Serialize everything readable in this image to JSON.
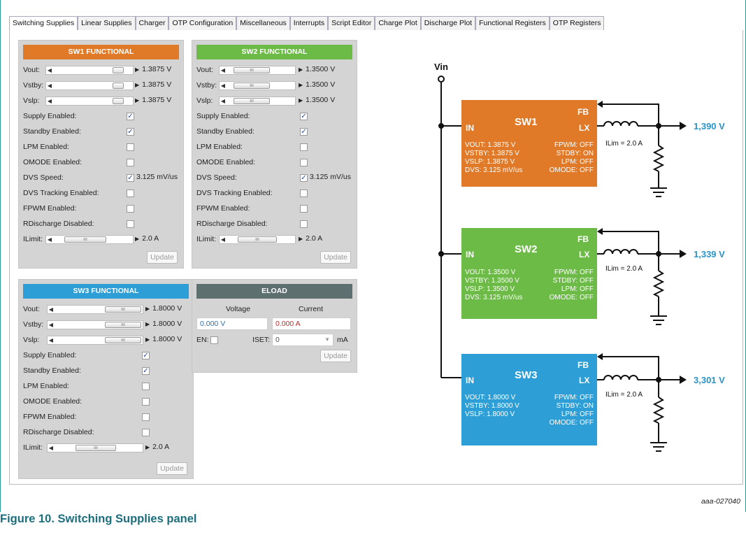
{
  "tabs": [
    "Switching Supplies",
    "Linear Supplies",
    "Charger",
    "OTP Configuration",
    "Miscellaneous",
    "Interrupts",
    "Script Editor",
    "Charge Plot",
    "Discharge Plot",
    "Functional Registers",
    "OTP Registers"
  ],
  "colors": {
    "sw1": "#e07a28",
    "sw2": "#6cbb46",
    "sw3": "#2d9fd6",
    "eload": "#5d6f6f",
    "output": "#2a93c8"
  },
  "sw1": {
    "title": "SW1 FUNCTIONAL",
    "vout_label": "Vout:",
    "vout_value": "1.3875 V",
    "vstby_label": "Vstby:",
    "vstby_value": "1.3875 V",
    "vslp_label": "Vslp:",
    "vslp_value": "1.3875 V",
    "supply_enabled": "Supply Enabled:",
    "standby_enabled": "Standby Enabled:",
    "lpm_enabled": "LPM Enabled:",
    "omode_enabled": "OMODE Enabled:",
    "dvs_speed": "DVS Speed:",
    "dvs_speed_value": "3.125 mV/us",
    "dvs_tracking": "DVS Tracking Enabled:",
    "fpwm_enabled": "FPWM Enabled:",
    "rdischarge": "RDischarge Disabled:",
    "ilimit_label": "ILimit:",
    "ilimit_value": "2.0 A",
    "update": "Update"
  },
  "sw2": {
    "title": "SW2 FUNCTIONAL",
    "vout_label": "Vout:",
    "vout_value": "1.3500 V",
    "vstby_label": "Vstby:",
    "vstby_value": "1.3500 V",
    "vslp_label": "Vslp:",
    "vslp_value": "1.3500 V",
    "supply_enabled": "Supply Enabled:",
    "standby_enabled": "Standby Enabled:",
    "lpm_enabled": "LPM Enabled:",
    "omode_enabled": "OMODE Enabled:",
    "dvs_speed": "DVS Speed:",
    "dvs_speed_value": "3.125 mV/us",
    "dvs_tracking": "DVS Tracking Enabled:",
    "fpwm_enabled": "FPWM Enabled:",
    "rdischarge": "RDischarge Disabled:",
    "ilimit_label": "ILimit:",
    "ilimit_value": "2.0 A",
    "update": "Update"
  },
  "sw3": {
    "title": "SW3 FUNCTIONAL",
    "vout_label": "Vout:",
    "vout_value": "1.8000 V",
    "vstby_label": "Vstby:",
    "vstby_value": "1.8000 V",
    "vslp_label": "Vslp:",
    "vslp_value": "1.8000 V",
    "supply_enabled": "Supply Enabled:",
    "standby_enabled": "Standby Enabled:",
    "lpm_enabled": "LPM Enabled:",
    "omode_enabled": "OMODE Enabled:",
    "fpwm_enabled": "FPWM Enabled:",
    "rdischarge": "RDischarge Disabled:",
    "ilimit_label": "ILimit:",
    "ilimit_value": "2.0 A",
    "update": "Update"
  },
  "eload": {
    "title": "ELOAD",
    "voltage_header": "Voltage",
    "current_header": "Current",
    "voltage_value": "0.000 V",
    "current_value": "0.000 A",
    "en_label": "EN:",
    "iset_label": "ISET:",
    "iset_value": "0",
    "iset_unit": "mA",
    "update": "Update"
  },
  "diagram": {
    "vin": "Vin",
    "sw1": {
      "name": "SW1",
      "in": "IN",
      "fb": "FB",
      "lx": "LX",
      "left": [
        "VOUT: 1.3875 V",
        "VSTBY: 1.3875 V",
        "VSLP: 1.3875 V",
        "DVS: 3.125 mV/us"
      ],
      "right": [
        "FPWM: OFF",
        "STDBY: ON",
        "LPM: OFF",
        "OMODE: OFF"
      ],
      "ilim": "ILim = 2.0 A",
      "output": "1,390 V"
    },
    "sw2": {
      "name": "SW2",
      "in": "IN",
      "fb": "FB",
      "lx": "LX",
      "left": [
        "VOUT: 1.3500 V",
        "VSTBY: 1.3500 V",
        "VSLP: 1.3500 V",
        "DVS: 3.125 mV/us"
      ],
      "right": [
        "FPWM: OFF",
        "STDBY: OFF",
        "LPM: OFF",
        "OMODE: OFF"
      ],
      "ilim": "ILim = 2.0 A",
      "output": "1,339 V"
    },
    "sw3": {
      "name": "SW3",
      "in": "IN",
      "fb": "FB",
      "lx": "LX",
      "left": [
        "VOUT: 1.8000 V",
        "VSTBY: 1.8000 V",
        "VSLP: 1.8000 V"
      ],
      "right": [
        "FPWM: OFF",
        "STDBY: ON",
        "LPM: OFF",
        "OMODE: OFF"
      ],
      "ilim": "ILim = 2.0 A",
      "output": "3,301 V"
    }
  },
  "figure_id": "aaa-027040",
  "caption": "Figure 10.  Switching Supplies panel"
}
